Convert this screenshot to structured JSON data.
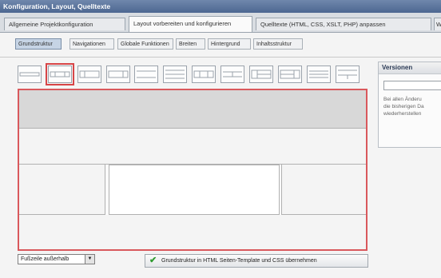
{
  "window": {
    "title": "Konfiguration, Layout, Quelltexte"
  },
  "tabs": [
    {
      "label": "Allgemeine Projektkonfiguration",
      "active": false
    },
    {
      "label": "Layout vorbereiten und konfigurieren",
      "active": true
    },
    {
      "label": "Quelltexte (HTML, CSS, XSLT, PHP) anpassen",
      "active": false
    },
    {
      "label": "W",
      "active": false
    }
  ],
  "subtabs": [
    {
      "label": "Grundstruktur",
      "active": true
    },
    {
      "label": "Navigationen",
      "active": false
    },
    {
      "label": "Globale Funktionen",
      "active": false
    },
    {
      "label": "Breiten",
      "active": false
    },
    {
      "label": "Hintergrund",
      "active": false
    },
    {
      "label": "Inhaltsstruktur",
      "active": false
    }
  ],
  "layout_templates": {
    "selected_index": 1
  },
  "versions_panel": {
    "title": "Versionen",
    "input_value": "",
    "note_lines": [
      "Bei allen Änderu",
      "die bisherigen Da",
      "wiederherstellen"
    ]
  },
  "footer_option": {
    "selected": "Fußzeile außerhalb"
  },
  "apply_button": {
    "label": "Grundstruktur in HTML Seiten-Template und CSS übernehmen"
  },
  "colors": {
    "title_bar": "#5a7299",
    "selection_border": "#d9585c",
    "header_region": "#d8d8d8",
    "content_region": "#ffffff",
    "check": "#2f9b2f"
  }
}
